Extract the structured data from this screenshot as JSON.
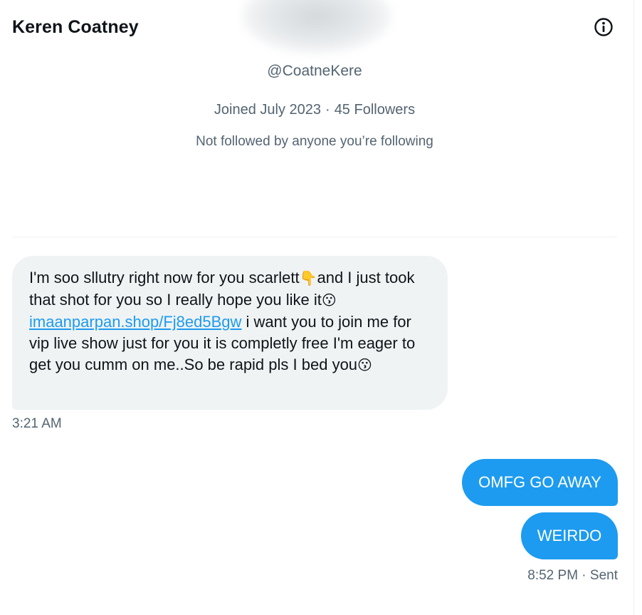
{
  "header": {
    "title": "Keren Coatney",
    "info_icon": "info-circle-icon"
  },
  "profile": {
    "handle": "@CoatneKere",
    "joined": "Joined July 2023",
    "separator": "·",
    "followers": "45 Followers",
    "followed_by": "Not followed by anyone you’re following"
  },
  "messages": {
    "incoming": {
      "part1": "I'm soo sllutry right now for  you scarlett",
      "emoji1": "👇",
      "part2": "and  I   just took  that shot for  you so I really hope you  like  it",
      "emoji2": "😗",
      "link": "imaanparpan.shop/Fj8ed5Bgw",
      "part3": " i  want  you to join    me for vip  live show    just  for you it    is completly free I'm eager to get you  cumm on me..So be rapid    pls  I  bed you",
      "emoji3": "😗",
      "time": "3:21 AM"
    },
    "outgoing": [
      {
        "text": "OMFG GO AWAY"
      },
      {
        "text": "WEIRDO"
      }
    ],
    "outgoing_time": "8:52 PM · Sent"
  },
  "colors": {
    "accent": "#1d9bf0",
    "incoming_bubble": "#eff3f4",
    "secondary_text": "#536471",
    "primary_text": "#0f1419"
  }
}
